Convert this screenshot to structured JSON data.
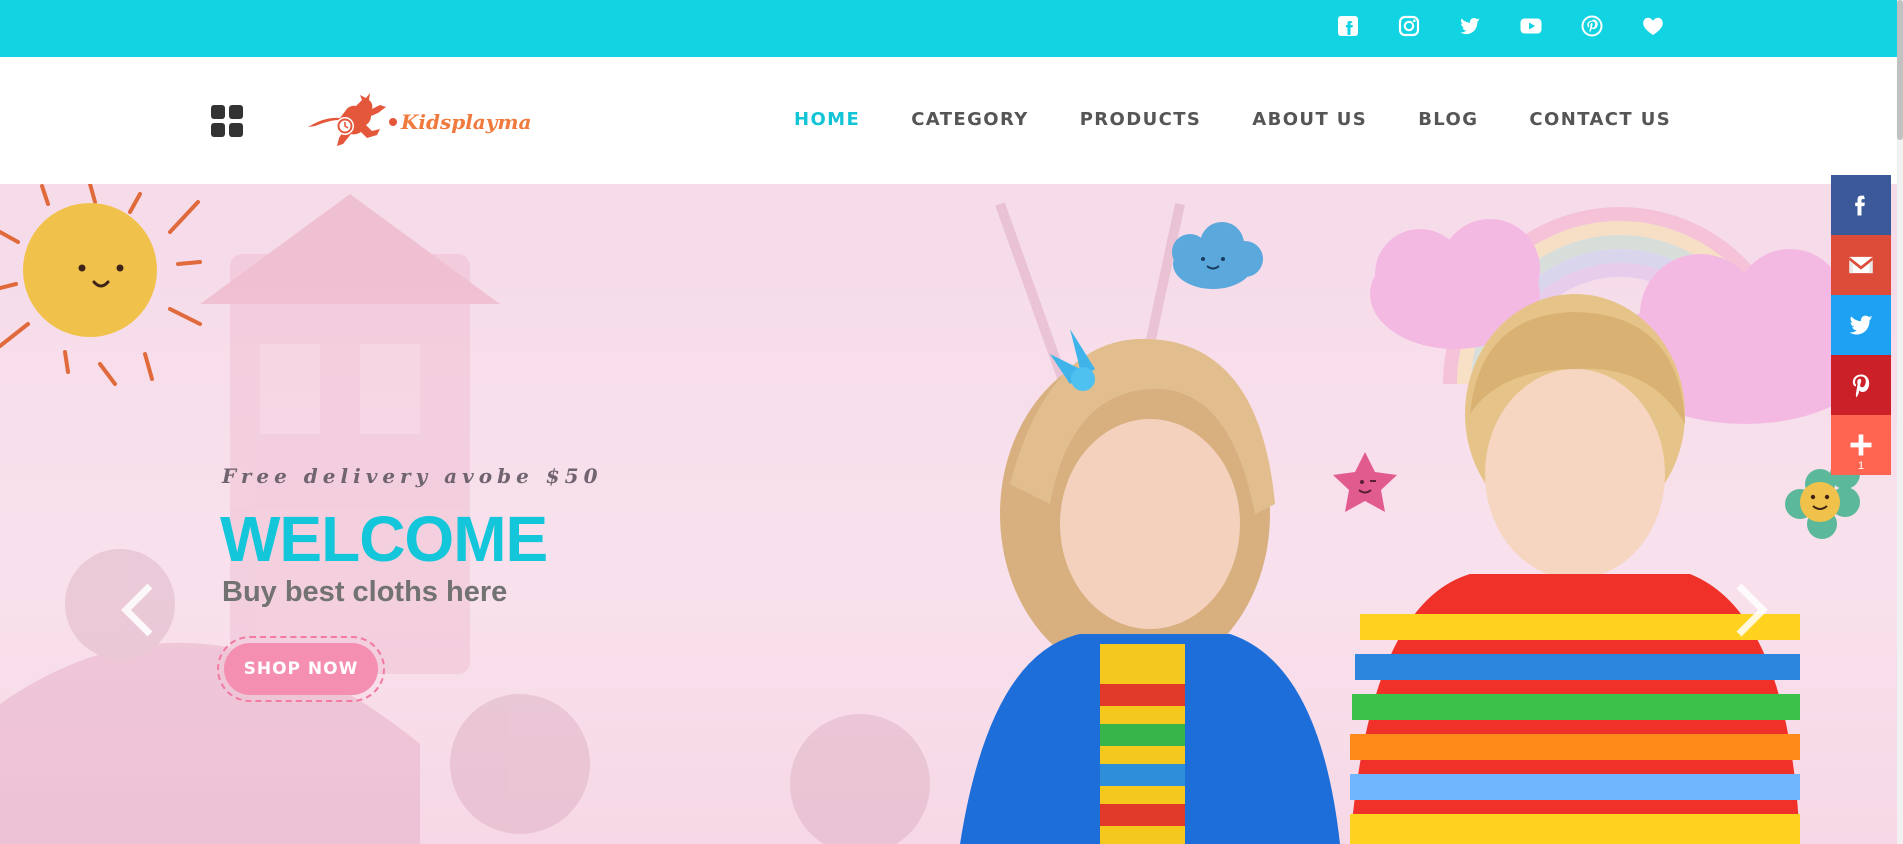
{
  "topbar": {
    "background": "#11d3e1",
    "social_icons": [
      "facebook-icon",
      "instagram-icon",
      "twitter-icon",
      "youtube-icon",
      "pinterest-icon",
      "heart-icon"
    ]
  },
  "header": {
    "logo_text": "Kidsplaymart",
    "nav": [
      "HOME",
      "CATEGORY",
      "PRODUCTS",
      "ABOUT US",
      "BLOG",
      "CONTACT US"
    ],
    "active_nav": "HOME"
  },
  "hero": {
    "tagline": "Free delivery avobe $50",
    "title": "WELCOME",
    "subtitle": "Buy best cloths here",
    "button": "SHOP NOW"
  },
  "share_bar": {
    "items": [
      {
        "icon": "facebook-icon",
        "color": "#3b5998"
      },
      {
        "icon": "gmail-icon",
        "color": "#dd4b39"
      },
      {
        "icon": "twitter-icon",
        "color": "#1da1f2"
      },
      {
        "icon": "pinterest-icon",
        "color": "#cb2027"
      },
      {
        "icon": "plus-icon",
        "color": "#ff6550"
      }
    ],
    "count": "1"
  },
  "colors": {
    "accent": "#11c4d6",
    "button_pink": "#f48fb1",
    "nav_text": "#555555"
  }
}
